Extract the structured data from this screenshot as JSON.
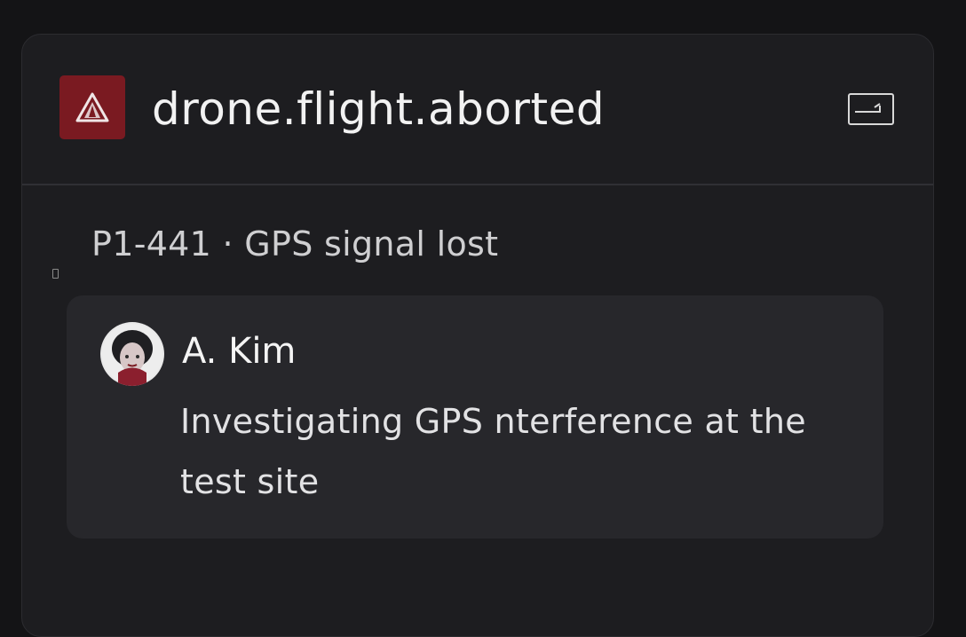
{
  "header": {
    "title": "drone.flight.aborted",
    "icon": "alert-triangle-icon",
    "accent_color": "#7a1a21",
    "collapse_icon": "collapse-panel-icon"
  },
  "event": {
    "subtitle": "P1-441 · GPS signal lost"
  },
  "comment": {
    "author": "A. Kim",
    "avatar_icon": "user-avatar",
    "message": "Investigating GPS nterference at the test site"
  }
}
